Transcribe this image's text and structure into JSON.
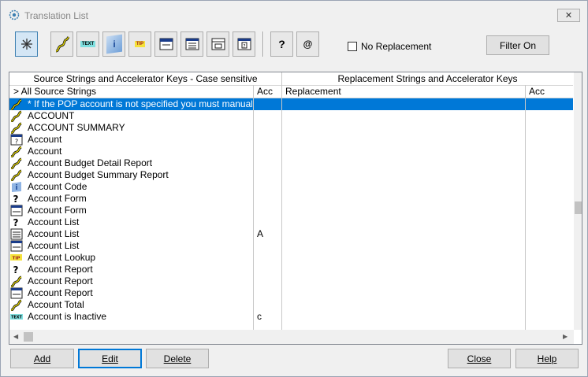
{
  "window": {
    "title": "Translation List",
    "close_glyph": "✕"
  },
  "toolbar": {
    "no_replacement_label": "No Replacement",
    "filter_on_label": "Filter On",
    "buttons": [
      {
        "name": "all-strings-icon"
      },
      {
        "name": "wire-icon"
      },
      {
        "name": "text-icon",
        "label": "TEXT"
      },
      {
        "name": "info-icon",
        "label": "i"
      },
      {
        "name": "tip-icon",
        "label": "TIP"
      },
      {
        "name": "form-icon"
      },
      {
        "name": "list-icon"
      },
      {
        "name": "report-icon"
      },
      {
        "name": "dialog-icon"
      },
      {
        "name": "help-query-icon",
        "label": "?"
      },
      {
        "name": "at-icon",
        "label": "@"
      }
    ]
  },
  "grid": {
    "header_left": "Source Strings and Accelerator Keys - Case sensitive",
    "header_right": "Replacement Strings and Accelerator Keys",
    "col_source_first": "> All Source Strings",
    "col_acc": "Acc",
    "col_replacement": "Replacement",
    "col_acc2": "Acc",
    "rows": [
      {
        "icon": "wire",
        "text": "* If the POP account is not specified you must manual",
        "acc": "",
        "selected": true
      },
      {
        "icon": "wire",
        "text": "ACCOUNT",
        "acc": ""
      },
      {
        "icon": "wire",
        "text": "ACCOUNT SUMMARY",
        "acc": ""
      },
      {
        "icon": "dialog",
        "text": "Account",
        "acc": ""
      },
      {
        "icon": "wire",
        "text": "Account",
        "acc": ""
      },
      {
        "icon": "wire",
        "text": "Account Budget Detail Report",
        "acc": ""
      },
      {
        "icon": "wire",
        "text": "Account Budget Summary Report",
        "acc": ""
      },
      {
        "icon": "info",
        "text": "Account Code",
        "acc": ""
      },
      {
        "icon": "query",
        "text": "Account Form",
        "acc": ""
      },
      {
        "icon": "form",
        "text": "Account Form",
        "acc": ""
      },
      {
        "icon": "query",
        "text": "Account List",
        "acc": ""
      },
      {
        "icon": "list",
        "text": "Account List",
        "acc": "A"
      },
      {
        "icon": "form",
        "text": "Account List",
        "acc": ""
      },
      {
        "icon": "tip",
        "text": "Account Lookup",
        "acc": ""
      },
      {
        "icon": "query",
        "text": "Account Report",
        "acc": ""
      },
      {
        "icon": "wire",
        "text": "Account Report",
        "acc": ""
      },
      {
        "icon": "form",
        "text": "Account Report",
        "acc": ""
      },
      {
        "icon": "wire",
        "text": "Account Total",
        "acc": ""
      },
      {
        "icon": "text",
        "text": "Account is Inactive",
        "acc": "c"
      }
    ]
  },
  "footer": {
    "add_label": "Add",
    "edit_label": "Edit",
    "delete_label": "Delete",
    "close_label": "Close",
    "help_label": "Help"
  }
}
